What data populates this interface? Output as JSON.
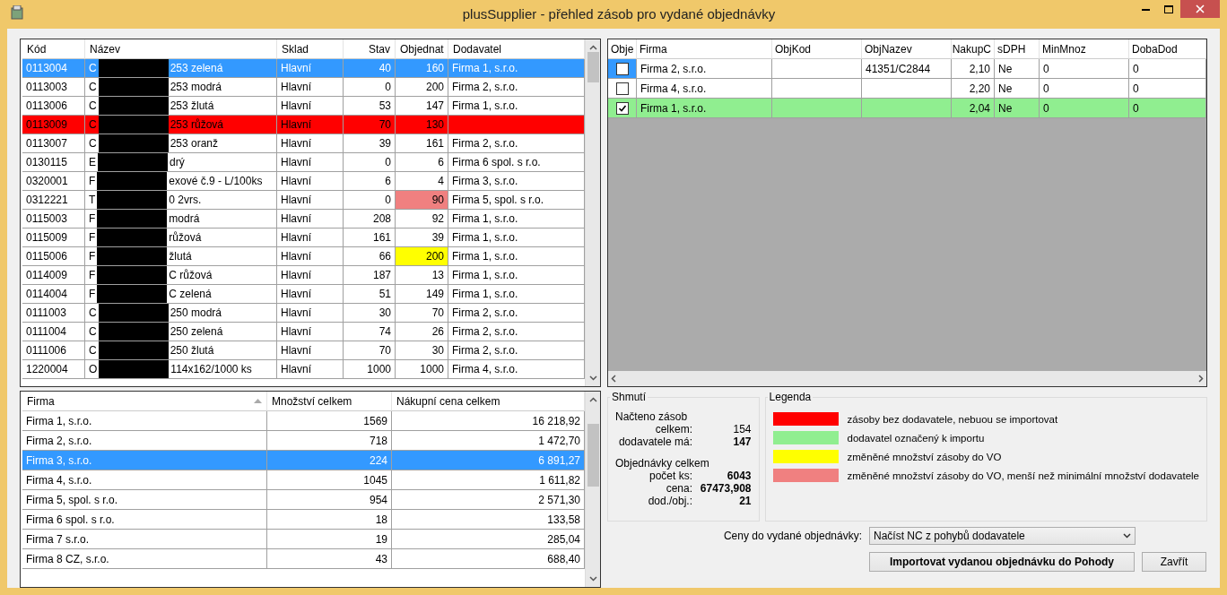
{
  "window": {
    "title": "plusSupplier - přehled zásob pro vydané objednávky"
  },
  "stock_table": {
    "columns": [
      "Kód",
      "Název",
      "Sklad",
      "Stav",
      "Objednat",
      "Dodavatel"
    ],
    "rows": [
      {
        "code": "0113004",
        "name_start": "C",
        "name_end": "253 zelená",
        "warehouse": "Hlavní",
        "stock": "40",
        "order": "160",
        "supplier": "Firma 1, s.r.o.",
        "selected": true,
        "missing_supplier": false,
        "order_changed": false,
        "below_minimum": false
      },
      {
        "code": "0113003",
        "name_start": "C",
        "name_end": "253 modrá",
        "warehouse": "Hlavní",
        "stock": "0",
        "order": "200",
        "supplier": "Firma 2, s.r.o.",
        "selected": false,
        "missing_supplier": false,
        "order_changed": false,
        "below_minimum": false
      },
      {
        "code": "0113006",
        "name_start": "C",
        "name_end": "253 žlutá",
        "warehouse": "Hlavní",
        "stock": "53",
        "order": "147",
        "supplier": "Firma 1, s.r.o.",
        "selected": false,
        "missing_supplier": false,
        "order_changed": false,
        "below_minimum": false
      },
      {
        "code": "0113009",
        "name_start": "C",
        "name_end": "253 růžová",
        "warehouse": "Hlavní",
        "stock": "70",
        "order": "130",
        "selected": false,
        "missing_supplier": true,
        "order_changed": false,
        "below_minimum": false
      },
      {
        "code": "0113007",
        "name_start": "C",
        "name_end": "253 oranž",
        "warehouse": "Hlavní",
        "stock": "39",
        "order": "161",
        "supplier": "Firma 2, s.r.o.",
        "selected": false,
        "missing_supplier": false,
        "order_changed": false,
        "below_minimum": false
      },
      {
        "code": "0130115",
        "name_start": "E",
        "name_end": "drý",
        "warehouse": "Hlavní",
        "stock": "0",
        "order": "6",
        "supplier": "Firma 6 spol. s r.o.",
        "selected": false,
        "missing_supplier": false,
        "order_changed": false,
        "below_minimum": false
      },
      {
        "code": "0320001",
        "name_start": "F",
        "name_end": "exové č.9 - L/100ks",
        "warehouse": "Hlavní",
        "stock": "6",
        "order": "4",
        "supplier": "Firma 3, s.r.o.",
        "selected": false,
        "missing_supplier": false,
        "order_changed": false,
        "below_minimum": false
      },
      {
        "code": "0312221",
        "name_start": "T",
        "name_end": "0 2vrs.",
        "warehouse": "Hlavní",
        "stock": "0",
        "order": "90",
        "supplier": "Firma 5, spol. s r.o.",
        "selected": false,
        "missing_supplier": false,
        "order_changed": true,
        "below_minimum": true
      },
      {
        "code": "0115003",
        "name_start": "F",
        "name_end": "modrá",
        "warehouse": "Hlavní",
        "stock": "208",
        "order": "92",
        "supplier": "Firma 1, s.r.o.",
        "selected": false,
        "missing_supplier": false,
        "order_changed": false,
        "below_minimum": false
      },
      {
        "code": "0115009",
        "name_start": "F",
        "name_end": "růžová",
        "warehouse": "Hlavní",
        "stock": "161",
        "order": "39",
        "supplier": "Firma 1, s.r.o.",
        "selected": false,
        "missing_supplier": false,
        "order_changed": false,
        "below_minimum": false
      },
      {
        "code": "0115006",
        "name_start": "F",
        "name_end": "žlutá",
        "warehouse": "Hlavní",
        "stock": "66",
        "order": "200",
        "supplier": "Firma 1, s.r.o.",
        "selected": false,
        "missing_supplier": false,
        "order_changed": true,
        "below_minimum": false
      },
      {
        "code": "0114009",
        "name_start": "F",
        "name_end": "C růžová",
        "warehouse": "Hlavní",
        "stock": "187",
        "order": "13",
        "supplier": "Firma 1, s.r.o.",
        "selected": false,
        "missing_supplier": false,
        "order_changed": false,
        "below_minimum": false
      },
      {
        "code": "0114004",
        "name_start": "F",
        "name_end": "C zelená",
        "warehouse": "Hlavní",
        "stock": "51",
        "order": "149",
        "supplier": "Firma 1, s.r.o.",
        "selected": false,
        "missing_supplier": false,
        "order_changed": false,
        "below_minimum": false
      },
      {
        "code": "0111003",
        "name_start": "C",
        "name_end": "250 modrá",
        "warehouse": "Hlavní",
        "stock": "30",
        "order": "70",
        "supplier": "Firma 2, s.r.o.",
        "selected": false,
        "missing_supplier": false,
        "order_changed": false,
        "below_minimum": false
      },
      {
        "code": "0111004",
        "name_start": "C",
        "name_end": "250 zelená",
        "warehouse": "Hlavní",
        "stock": "74",
        "order": "26",
        "supplier": "Firma 2, s.r.o.",
        "selected": false,
        "missing_supplier": false,
        "order_changed": false,
        "below_minimum": false
      },
      {
        "code": "0111006",
        "name_start": "C",
        "name_end": "250 žlutá",
        "warehouse": "Hlavní",
        "stock": "70",
        "order": "30",
        "supplier": "Firma 2, s.r.o.",
        "selected": false,
        "missing_supplier": false,
        "order_changed": false,
        "below_minimum": false
      },
      {
        "code": "1220004",
        "name_start": "O",
        "name_end": "114x162/1000 ks",
        "warehouse": "Hlavní",
        "stock": "1000",
        "order": "1000",
        "supplier": "Firma 4, s.r.o.",
        "selected": false,
        "missing_supplier": false,
        "order_changed": false,
        "below_minimum": false
      }
    ]
  },
  "totals_table": {
    "columns": [
      "Firma",
      "Množství celkem",
      "Nákupní cena celkem"
    ],
    "rows": [
      {
        "firm": "Firma 1, s.r.o.",
        "quantity": "1569",
        "price": "16 218,92",
        "selected": false
      },
      {
        "firm": "Firma 2, s.r.o.",
        "quantity": "718",
        "price": "1 472,70",
        "selected": false
      },
      {
        "firm": "Firma 3, s.r.o.",
        "quantity": "224",
        "price": "6 891,27",
        "selected": true
      },
      {
        "firm": "Firma 4, s.r.o.",
        "quantity": "1045",
        "price": "1 611,82",
        "selected": false
      },
      {
        "firm": "Firma 5, spol. s r.o.",
        "quantity": "954",
        "price": "2 571,30",
        "selected": false
      },
      {
        "firm": "Firma 6 spol. s r.o.",
        "quantity": "18",
        "price": "133,58",
        "selected": false
      },
      {
        "firm": "Firma 7 s.r.o.",
        "quantity": "19",
        "price": "285,04",
        "selected": false
      },
      {
        "firm": "Firma 8 CZ, s.r.o.",
        "quantity": "43",
        "price": "688,40",
        "selected": false
      }
    ]
  },
  "supplier_table": {
    "columns": [
      "Obje",
      "Firma",
      "ObjKod",
      "ObjNazev",
      "NakupC",
      "sDPH",
      "MinMnoz",
      "DobaDod"
    ],
    "rows": [
      {
        "checked": false,
        "selected": true,
        "firm": "Firma 2, s.r.o.",
        "order_name": "41351/C2844",
        "price": "2,10",
        "vat": "Ne",
        "min_qty": "0",
        "lead_time": "0"
      },
      {
        "checked": false,
        "selected": false,
        "firm": "Firma 4, s.r.o.",
        "price": "2,20",
        "vat": "Ne",
        "min_qty": "0",
        "lead_time": "0"
      },
      {
        "checked": true,
        "selected": false,
        "firm": "Firma 1, s.r.o.",
        "price": "2,04",
        "vat": "Ne",
        "min_qty": "0",
        "lead_time": "0"
      }
    ]
  },
  "summary": {
    "title": "Shmutí",
    "loaded_heading": "Načteno zásob",
    "loaded": [
      {
        "label": "celkem:",
        "value": "154",
        "bold": false
      },
      {
        "label": "dodavatele má:",
        "value": "147",
        "bold": true
      }
    ],
    "orders_heading": "Objednávky celkem",
    "orders": [
      {
        "label": "počet ks:",
        "value": "6043",
        "bold": true
      },
      {
        "label": "cena:",
        "value": "67473,908",
        "bold": true
      },
      {
        "label": "dod./obj.:",
        "value": "21",
        "bold": true
      }
    ]
  },
  "legend": {
    "title": "Legenda",
    "items": [
      {
        "color": "#ff0000",
        "label": "zásoby bez dodavatele, nebuou se importovat"
      },
      {
        "color": "#90ee90",
        "label": "dodavatel označený k importu"
      },
      {
        "color": "#ffff00",
        "label": "změněné množství zásoby do VO"
      },
      {
        "color": "#f08080",
        "label": "změněné množství zásoby do VO, menší než minimální množství dodavatele"
      }
    ]
  },
  "price_source": {
    "label": "Ceny do vydané objednávky:",
    "value": "Načíst NC z pohybů dodavatele"
  },
  "buttons": [
    {
      "label": "Importovat vydanou objednávku do Pohody",
      "kind": "primary"
    },
    {
      "label": "Zavřít",
      "kind": "normal"
    }
  ]
}
